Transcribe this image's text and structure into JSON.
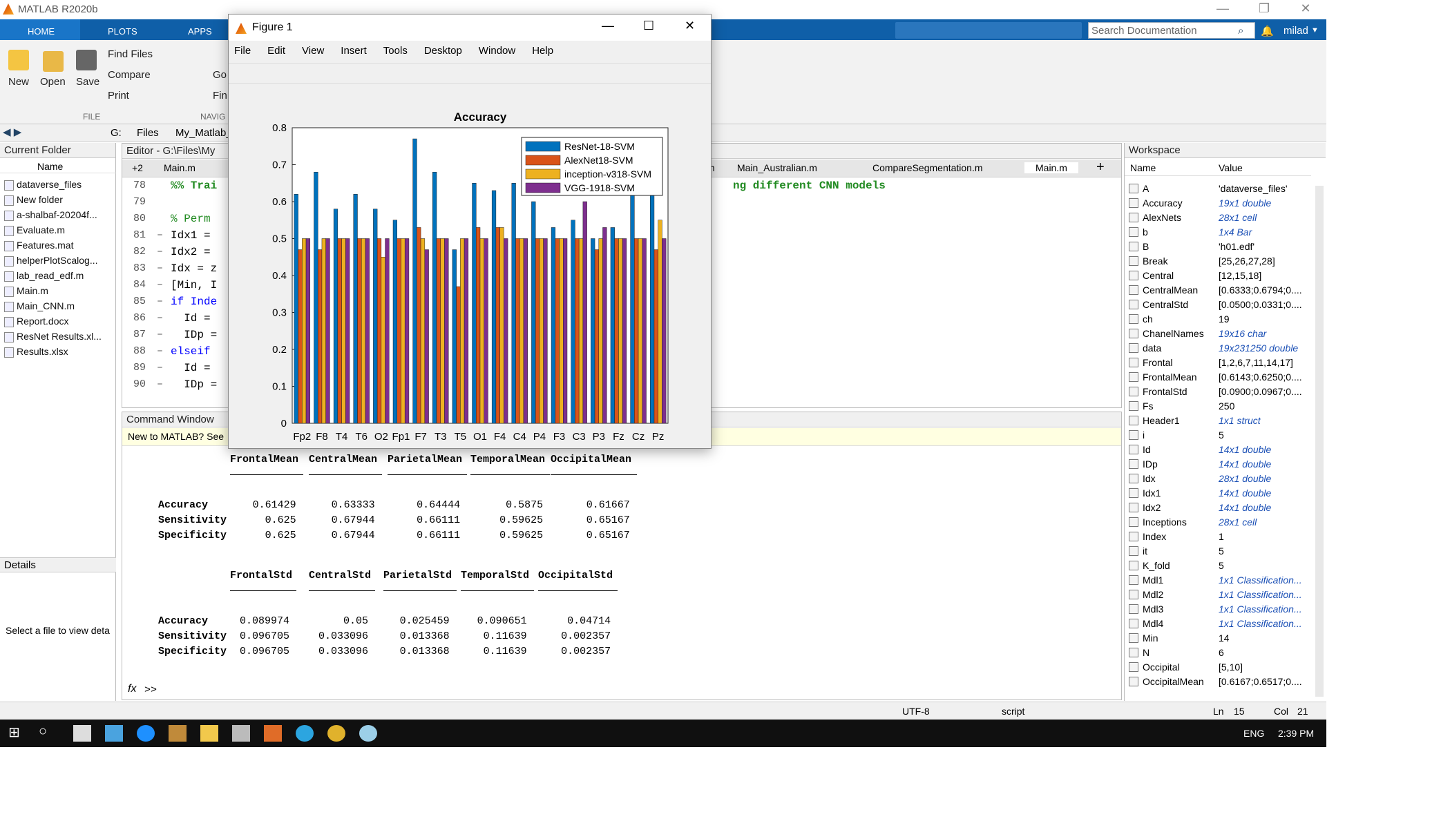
{
  "window": {
    "title": "MATLAB R2020b"
  },
  "tabs": [
    "HOME",
    "PLOTS",
    "APPS"
  ],
  "search": {
    "placeholder": "Search Documentation"
  },
  "user": "milad",
  "ribbon": {
    "new": "New",
    "open": "Open",
    "save": "Save",
    "find_files": "Find Files",
    "compare": "Compare",
    "print": "Print",
    "go": "Go",
    "find": "Fin",
    "file_section": "FILE",
    "navigate_section": "NAVIG"
  },
  "address": {
    "g": "G:",
    "files": "Files",
    "folder": "My_Matlab_"
  },
  "current_folder": {
    "title": "Current Folder",
    "col_name": "Name",
    "items": [
      "dataverse_files",
      "New folder",
      "a-shalbaf-20204f...",
      "Evaluate.m",
      "Features.mat",
      "helperPlotScalog...",
      "lab_read_edf.m",
      "Main.m",
      "Main_CNN.m",
      "Report.docx",
      "ResNet Results.xl...",
      "Results.xlsx"
    ],
    "details": "Details",
    "details_text": "Select a file to view deta"
  },
  "editor": {
    "title": "Editor - G:\\Files\\My",
    "tabs": [
      "Main.m",
      "m",
      "Main_Australian.m",
      "CompareSegmentation.m",
      "Main.m"
    ],
    "tab_count": "+2",
    "lines": [
      {
        "num": "78",
        "dash": "",
        "code": "%% Trai",
        "tail": "ng different CNN models"
      },
      {
        "num": "79",
        "dash": "",
        "code": "",
        "tail": ""
      },
      {
        "num": "80",
        "dash": "",
        "code": "% Perm",
        "tail": ""
      },
      {
        "num": "81",
        "dash": "–",
        "code": "Idx1 =",
        "tail": ""
      },
      {
        "num": "82",
        "dash": "–",
        "code": "Idx2 =",
        "tail": ""
      },
      {
        "num": "83",
        "dash": "–",
        "code": "Idx = z",
        "tail": ""
      },
      {
        "num": "84",
        "dash": "–",
        "code": "[Min, I",
        "tail": ""
      },
      {
        "num": "85",
        "dash": "–",
        "code": "if Inde",
        "tail": ""
      },
      {
        "num": "86",
        "dash": "–",
        "code": "  Id =",
        "tail": ""
      },
      {
        "num": "87",
        "dash": "–",
        "code": "  IDp =",
        "tail": ""
      },
      {
        "num": "88",
        "dash": "–",
        "code": "elseif",
        "tail": ""
      },
      {
        "num": "89",
        "dash": "–",
        "code": "  Id =",
        "tail": ""
      },
      {
        "num": "90",
        "dash": "–",
        "code": "  IDp =",
        "tail": ""
      }
    ]
  },
  "command_window": {
    "title": "Command Window",
    "banner": "New to MATLAB? See",
    "table1": {
      "headers": [
        "FrontalMean",
        "CentralMean",
        "ParietalMean",
        "TemporalMean",
        "OccipitalMean"
      ],
      "rows": [
        [
          "Accuracy",
          "0.61429",
          "0.63333",
          "0.64444",
          "0.5875",
          "0.61667"
        ],
        [
          "Sensitivity",
          "0.625",
          "0.67944",
          "0.66111",
          "0.59625",
          "0.65167"
        ],
        [
          "Specificity",
          "0.625",
          "0.67944",
          "0.66111",
          "0.59625",
          "0.65167"
        ]
      ]
    },
    "table2": {
      "headers": [
        "FrontalStd",
        "CentralStd",
        "ParietalStd",
        "TemporalStd",
        "OccipitalStd"
      ],
      "rows": [
        [
          "Accuracy",
          "0.089974",
          "0.05",
          "0.025459",
          "0.090651",
          "0.04714"
        ],
        [
          "Sensitivity",
          "0.096705",
          "0.033096",
          "0.013368",
          "0.11639",
          "0.002357"
        ],
        [
          "Specificity",
          "0.096705",
          "0.033096",
          "0.013368",
          "0.11639",
          "0.002357"
        ]
      ]
    },
    "prompt": ">>",
    "fx": "fx"
  },
  "workspace": {
    "title": "Workspace",
    "col_name": "Name",
    "col_value": "Value",
    "vars": [
      {
        "n": "A",
        "v": "'dataverse_files'",
        "it": false
      },
      {
        "n": "Accuracy",
        "v": "19x1 double",
        "it": true
      },
      {
        "n": "AlexNets",
        "v": "28x1 cell",
        "it": true
      },
      {
        "n": "b",
        "v": "1x4 Bar",
        "it": true
      },
      {
        "n": "B",
        "v": "'h01.edf'",
        "it": false
      },
      {
        "n": "Break",
        "v": "[25,26,27,28]",
        "it": false
      },
      {
        "n": "Central",
        "v": "[12,15,18]",
        "it": false
      },
      {
        "n": "CentralMean",
        "v": "[0.6333;0.6794;0....",
        "it": false
      },
      {
        "n": "CentralStd",
        "v": "[0.0500;0.0331;0....",
        "it": false
      },
      {
        "n": "ch",
        "v": "19",
        "it": false
      },
      {
        "n": "ChanelNames",
        "v": "19x16 char",
        "it": true
      },
      {
        "n": "data",
        "v": "19x231250 double",
        "it": true
      },
      {
        "n": "Frontal",
        "v": "[1,2,6,7,11,14,17]",
        "it": false
      },
      {
        "n": "FrontalMean",
        "v": "[0.6143;0.6250;0....",
        "it": false
      },
      {
        "n": "FrontalStd",
        "v": "[0.0900;0.0967;0....",
        "it": false
      },
      {
        "n": "Fs",
        "v": "250",
        "it": false
      },
      {
        "n": "Header1",
        "v": "1x1 struct",
        "it": true
      },
      {
        "n": "i",
        "v": "5",
        "it": false
      },
      {
        "n": "Id",
        "v": "14x1 double",
        "it": true
      },
      {
        "n": "IDp",
        "v": "14x1 double",
        "it": true
      },
      {
        "n": "Idx",
        "v": "28x1 double",
        "it": true
      },
      {
        "n": "Idx1",
        "v": "14x1 double",
        "it": true
      },
      {
        "n": "Idx2",
        "v": "14x1 double",
        "it": true
      },
      {
        "n": "Inceptions",
        "v": "28x1 cell",
        "it": true
      },
      {
        "n": "Index",
        "v": "1",
        "it": false
      },
      {
        "n": "it",
        "v": "5",
        "it": false
      },
      {
        "n": "K_fold",
        "v": "5",
        "it": false
      },
      {
        "n": "Mdl1",
        "v": "1x1 Classification...",
        "it": true
      },
      {
        "n": "Mdl2",
        "v": "1x1 Classification...",
        "it": true
      },
      {
        "n": "Mdl3",
        "v": "1x1 Classification...",
        "it": true
      },
      {
        "n": "Mdl4",
        "v": "1x1 Classification...",
        "it": true
      },
      {
        "n": "Min",
        "v": "14",
        "it": false
      },
      {
        "n": "N",
        "v": "6",
        "it": false
      },
      {
        "n": "Occipital",
        "v": "[5,10]",
        "it": false
      },
      {
        "n": "OccipitalMean",
        "v": "[0.6167;0.6517;0....",
        "it": false
      }
    ]
  },
  "status": {
    "encoding": "UTF-8",
    "type": "script",
    "ln_label": "Ln",
    "ln": "15",
    "col_label": "Col",
    "col": "21"
  },
  "taskbar": {
    "lang": "ENG",
    "time": "2:39 PM"
  },
  "figure": {
    "title": "Figure 1",
    "menu": [
      "File",
      "Edit",
      "View",
      "Insert",
      "Tools",
      "Desktop",
      "Window",
      "Help"
    ]
  },
  "chart_data": {
    "type": "bar",
    "title": "Accuracy",
    "categories": [
      "Fp2",
      "F8",
      "T4",
      "T6",
      "O2",
      "Fp1",
      "F7",
      "T3",
      "T5",
      "O1",
      "F4",
      "C4",
      "P4",
      "F3",
      "C3",
      "P3",
      "Fz",
      "Cz",
      "Pz"
    ],
    "ylim": [
      0,
      0.8
    ],
    "yticks": [
      "0",
      "0.1",
      "0.2",
      "0.3",
      "0.4",
      "0.5",
      "0.6",
      "0.7",
      "0.8"
    ],
    "legend_position": "top-right",
    "series": [
      {
        "name": "ResNet-18-SVM",
        "color": "#0072BD",
        "values": [
          0.62,
          0.68,
          0.58,
          0.62,
          0.58,
          0.55,
          0.77,
          0.68,
          0.47,
          0.65,
          0.63,
          0.65,
          0.6,
          0.53,
          0.55,
          0.5,
          0.53,
          0.62,
          0.62
        ]
      },
      {
        "name": "AlexNet18-SVM",
        "color": "#D95319",
        "values": [
          0.47,
          0.47,
          0.5,
          0.5,
          0.5,
          0.5,
          0.53,
          0.5,
          0.37,
          0.53,
          0.53,
          0.5,
          0.5,
          0.5,
          0.5,
          0.47,
          0.5,
          0.5,
          0.47
        ]
      },
      {
        "name": "inception-v318-SVM",
        "color": "#EDB120",
        "values": [
          0.5,
          0.5,
          0.5,
          0.5,
          0.45,
          0.5,
          0.5,
          0.5,
          0.5,
          0.5,
          0.53,
          0.5,
          0.5,
          0.5,
          0.5,
          0.5,
          0.5,
          0.5,
          0.55
        ]
      },
      {
        "name": "VGG-1918-SVM",
        "color": "#7E2F8E",
        "values": [
          0.5,
          0.5,
          0.5,
          0.5,
          0.5,
          0.5,
          0.47,
          0.5,
          0.5,
          0.5,
          0.5,
          0.5,
          0.5,
          0.5,
          0.6,
          0.53,
          0.5,
          0.5,
          0.5
        ]
      }
    ]
  }
}
